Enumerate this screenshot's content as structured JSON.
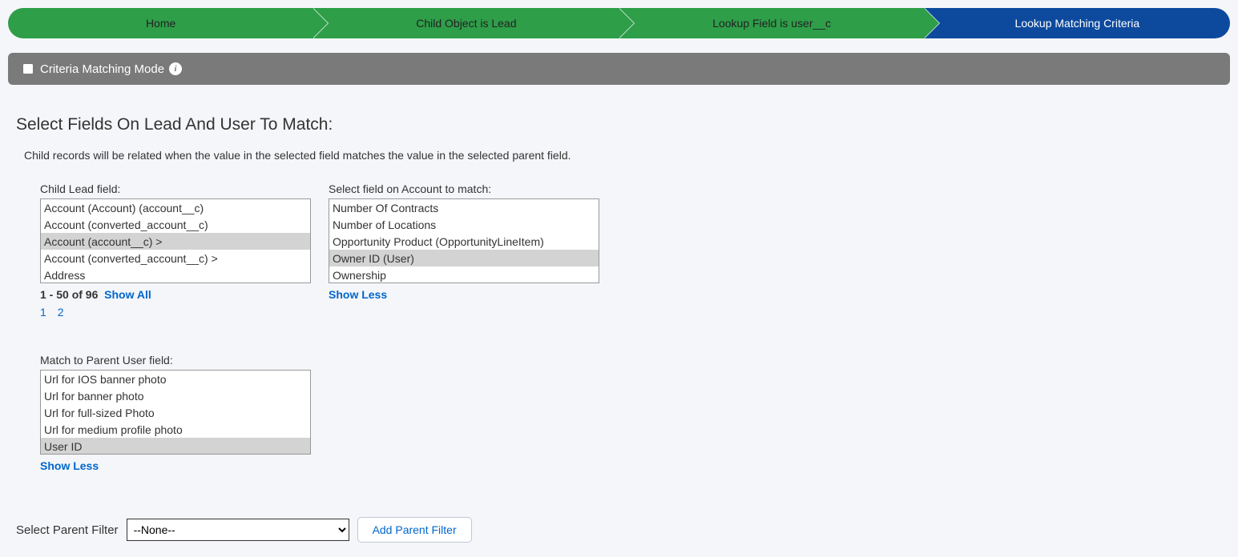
{
  "wizard": {
    "steps": [
      {
        "label": "Home",
        "active": false
      },
      {
        "label": "Child Object is Lead",
        "active": false
      },
      {
        "label": "Lookup Field is user__c",
        "active": false
      },
      {
        "label": "Lookup Matching Criteria",
        "active": true
      }
    ]
  },
  "modeBar": {
    "label": "Criteria Matching Mode",
    "checked": false
  },
  "heading": "Select Fields On Lead And User To Match:",
  "subtext": "Child records will be related when the value in the selected field matches the value in the selected parent field.",
  "childField": {
    "label": "Child Lead field:",
    "options": [
      "Account (Account) (account__c)",
      "Account (converted_account__c)",
      "Account (account__c) >",
      "Account (converted_account__c) >",
      "Address"
    ],
    "selectedIndex": 2,
    "pager": {
      "range": "1 - 50 of 96",
      "showAll": "Show All",
      "pages": [
        "1",
        "2"
      ]
    }
  },
  "accountField": {
    "label": "Select field on Account to match:",
    "options": [
      "Number Of Contracts",
      "Number of Locations",
      "Opportunity Product (OpportunityLineItem)",
      "Owner ID (User)",
      "Ownership"
    ],
    "selectedIndex": 3,
    "showLess": "Show Less"
  },
  "parentField": {
    "label": "Match to Parent User field:",
    "options": [
      "Url for IOS banner photo",
      "Url for banner photo",
      "Url for full-sized Photo",
      "Url for medium profile photo",
      "User ID"
    ],
    "selectedIndex": 4,
    "showLess": "Show Less"
  },
  "filter": {
    "label": "Select Parent Filter",
    "selected": "--None--",
    "button": "Add Parent Filter"
  }
}
